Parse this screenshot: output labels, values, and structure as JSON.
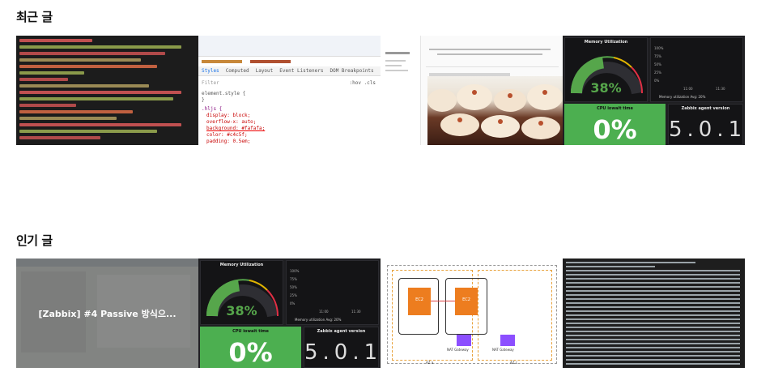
{
  "recent": {
    "title": "최근 글"
  },
  "popular": {
    "title": "인기 글",
    "cards": [
      {
        "title": "[Zabbix] #4 Passive 방식으..."
      }
    ]
  },
  "thumbs": {
    "devtools_tabs": [
      "Styles",
      "Computed",
      "Layout",
      "Event Listeners",
      "DOM Breakpoints"
    ],
    "devtools_filter": "Filter",
    "devtools_hov": ":hov .cls",
    "devtools_code": [
      "element.style {",
      "}",
      ".hljs {",
      "display: block;",
      "overflow-x: auto;",
      "background: #fafafa;",
      "color: #c4c5f;",
      "padding: 0.5em;"
    ],
    "grafana_memory": "Memory Utilization",
    "grafana_percent": "38%",
    "grafana_cpu": "CPU iowait time",
    "grafana_cpu_value": "0%",
    "grafana_agent": "Zabbix agent version",
    "grafana_agent_value": "5.0.1",
    "grafana_legend": "Memory utilization  Avg: 20%",
    "grafana_ticks": [
      "100%",
      "75%",
      "50%",
      "25%",
      "0%"
    ],
    "grafana_times": [
      "11:00",
      "11:30"
    ],
    "diagram_labels": [
      "EC2",
      "EC2",
      "NAT Gateway",
      "NAT Gateway",
      "AZ a",
      "AZ c"
    ]
  },
  "colors": {
    "green": "#4caf50",
    "panel_bg": "#141416",
    "dark_bg": "#1f1f22"
  }
}
